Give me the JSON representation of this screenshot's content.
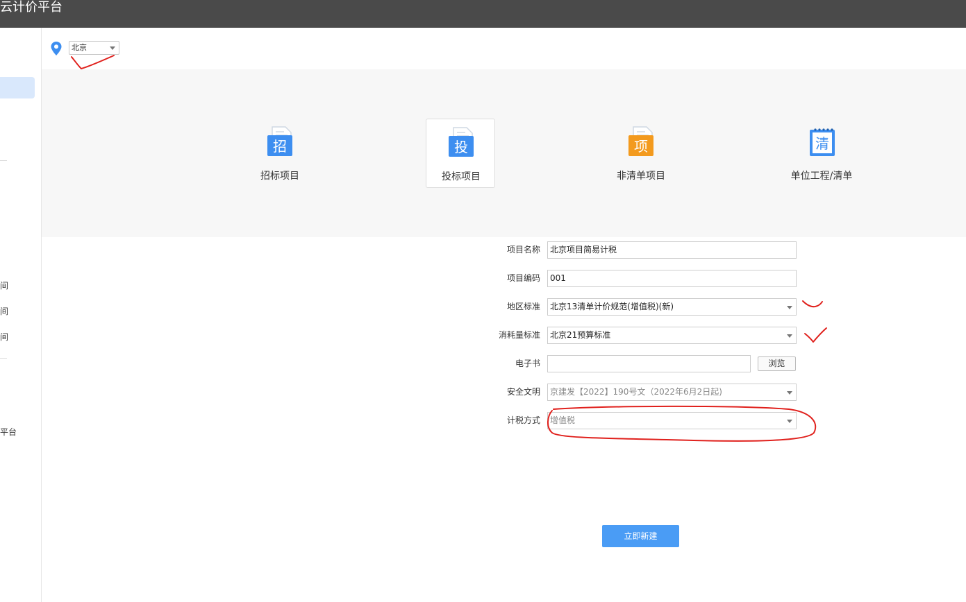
{
  "app": {
    "title": "云计价平台"
  },
  "sidebar": {
    "fragments": [
      "间",
      "间",
      "间",
      "平台"
    ]
  },
  "location": {
    "icon": "map-pin-icon",
    "selected_city": "北京"
  },
  "project_types": [
    {
      "label": "招标项目",
      "glyph": "招",
      "color": "#3d8ef0",
      "selected": false
    },
    {
      "label": "投标项目",
      "glyph": "投",
      "color": "#3d8ef0",
      "selected": true
    },
    {
      "label": "非清单项目",
      "glyph": "项",
      "color": "#f39a1e",
      "selected": false
    },
    {
      "label": "单位工程/清单",
      "glyph": "清",
      "color": "#3d8ef0",
      "selected": false
    }
  ],
  "form": {
    "project_name": {
      "label": "项目名称",
      "value": "北京项目简易计税"
    },
    "project_code": {
      "label": "项目编码",
      "value": "001"
    },
    "region_standard": {
      "label": "地区标准",
      "value": "北京13清单计价规范(增值税)(新)"
    },
    "consumption_standard": {
      "label": "消耗量标准",
      "value": "北京21预算标准"
    },
    "ebook": {
      "label": "电子书",
      "value": "",
      "browse_label": "浏览"
    },
    "safety_civilization": {
      "label": "安全文明",
      "value": "京建发【2022】190号文（2022年6月2日起)"
    },
    "tax_method": {
      "label": "计税方式",
      "value": "增值税"
    }
  },
  "actions": {
    "create_label": "立即新建"
  },
  "colors": {
    "titlebar": "#4a4a4a",
    "accent": "#4a9cf5",
    "annotation": "#e0201c"
  }
}
